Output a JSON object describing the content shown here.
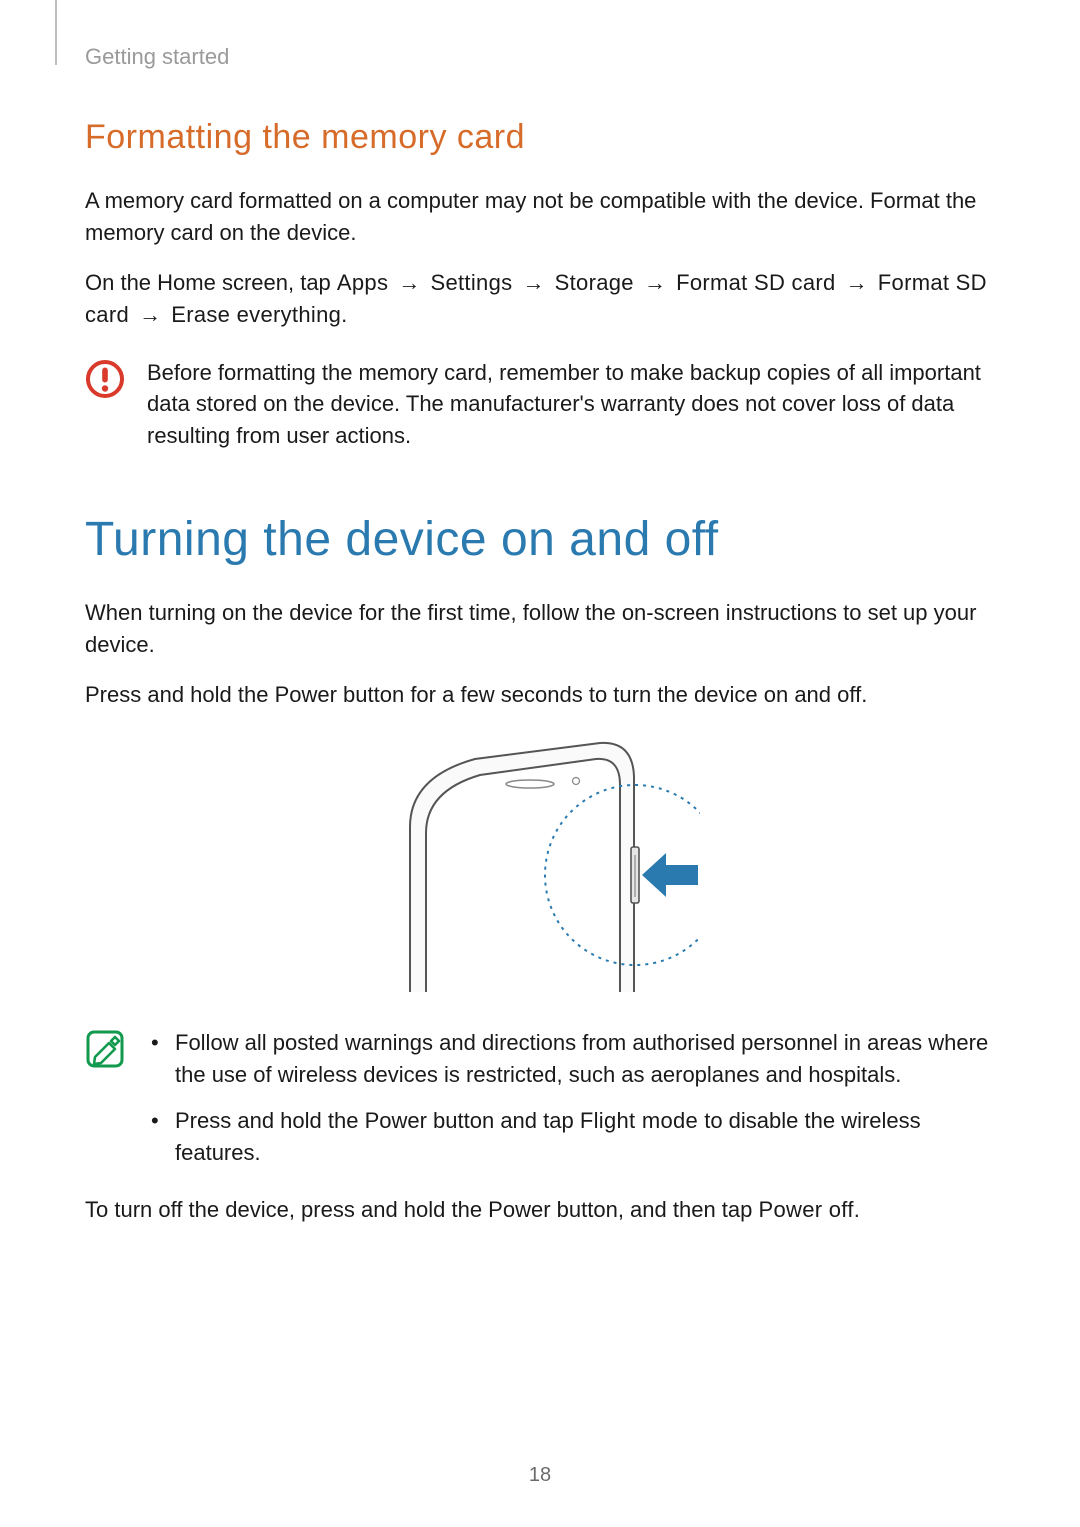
{
  "chapter": "Getting started",
  "sec1": {
    "heading": "Formatting the memory card",
    "p1": "A memory card formatted on a computer may not be compatible with the device. Format the memory card on the device.",
    "path_intro": "On the Home screen, tap ",
    "steps": [
      "Apps",
      "Settings",
      "Storage",
      "Format SD card",
      "Format SD card",
      "Erase everything"
    ],
    "warning": "Before formatting the memory card, remember to make backup copies of all important data stored on the device. The manufacturer's warranty does not cover loss of data resulting from user actions."
  },
  "sec2": {
    "heading": "Turning the device on and off",
    "p1": "When turning on the device for the first time, follow the on-screen instructions to set up your device.",
    "p2": "Press and hold the Power button for a few seconds to turn the device on and off.",
    "notes": [
      "Follow all posted warnings and directions from authorised personnel in areas where the use of wireless devices is restricted, such as aeroplanes and hospitals.",
      {
        "pre": "Press and hold the Power button and tap ",
        "label": "Flight mode",
        "post": " to disable the wireless features."
      }
    ],
    "p3_pre": "To turn off the device, press and hold the Power button, and then tap ",
    "p3_label": "Power off",
    "p3_post": "."
  },
  "page_number": "18",
  "icons": {
    "warning": "warning-icon",
    "note": "note-icon",
    "device": "device-power-illustration"
  }
}
